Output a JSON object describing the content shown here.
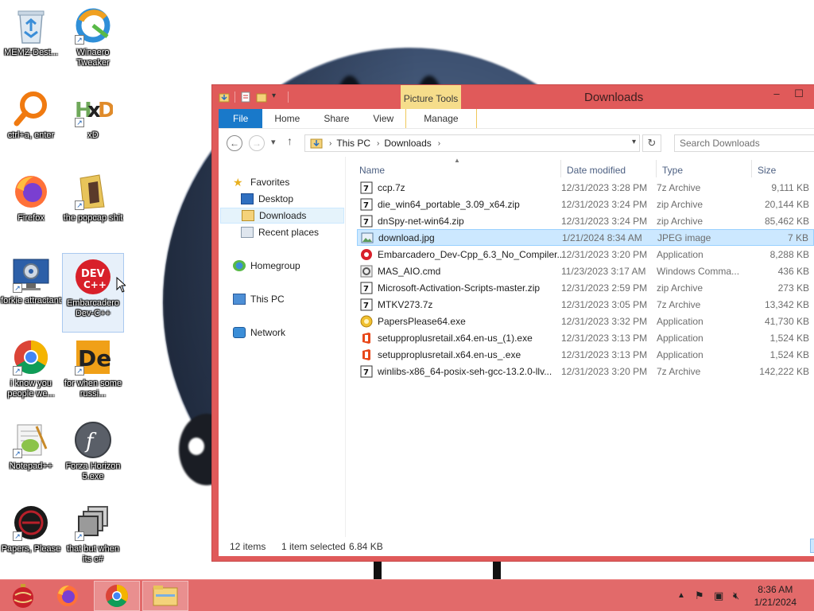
{
  "desktop": {
    "icons": [
      {
        "id": "memz",
        "label": "MEMZ-Dest..."
      },
      {
        "id": "winaero",
        "label": "Winaero Tweaker"
      },
      {
        "id": "ctrla",
        "label": "ctrl+a, enter"
      },
      {
        "id": "xd",
        "label": "xD"
      },
      {
        "id": "firefox",
        "label": "Firefox"
      },
      {
        "id": "popcap",
        "label": "the popcap shit"
      },
      {
        "id": "forkie",
        "label": "forkie attractant"
      },
      {
        "id": "embarcadero",
        "label": "Embarcadero Dev-C++"
      },
      {
        "id": "chrome",
        "label": "i know you people we..."
      },
      {
        "id": "forwhen",
        "label": "for when some russi..."
      },
      {
        "id": "notepadpp",
        "label": "Notepad++"
      },
      {
        "id": "forza",
        "label": "Forza Horizon 5.exe"
      },
      {
        "id": "papers",
        "label": "Papers, Please"
      },
      {
        "id": "thatbut",
        "label": "that but when its c#"
      }
    ]
  },
  "window": {
    "title": "Downloads",
    "contextual_tab_group": "Picture Tools",
    "tabs": [
      "File",
      "Home",
      "Share",
      "View",
      "Manage"
    ],
    "breadcrumb": [
      "This PC",
      "Downloads"
    ],
    "search_placeholder": "Search Downloads",
    "nav": {
      "favorites": "Favorites",
      "desktop": "Desktop",
      "downloads": "Downloads",
      "recent": "Recent places",
      "homegroup": "Homegroup",
      "thispc": "This PC",
      "network": "Network"
    },
    "columns": {
      "name": "Name",
      "date": "Date modified",
      "type": "Type",
      "size": "Size"
    },
    "files": [
      {
        "name": "ccp.7z",
        "date": "12/31/2023 3:28 PM",
        "type": "7z Archive",
        "size": "9,111 KB",
        "icon": "archive-icon"
      },
      {
        "name": "die_win64_portable_3.09_x64.zip",
        "date": "12/31/2023 3:24 PM",
        "type": "zip Archive",
        "size": "20,144 KB",
        "icon": "archive-icon"
      },
      {
        "name": "dnSpy-net-win64.zip",
        "date": "12/31/2023 3:24 PM",
        "type": "zip Archive",
        "size": "85,462 KB",
        "icon": "archive-icon"
      },
      {
        "name": "download.jpg",
        "date": "1/21/2024 8:34 AM",
        "type": "JPEG image",
        "size": "7 KB",
        "icon": "image-icon"
      },
      {
        "name": "Embarcadero_Dev-Cpp_6.3_No_Compiler...",
        "date": "12/31/2023 3:20 PM",
        "type": "Application",
        "size": "8,288 KB",
        "icon": "devcpp-icon"
      },
      {
        "name": "MAS_AIO.cmd",
        "date": "11/23/2023 3:17 AM",
        "type": "Windows Comma...",
        "size": "436 KB",
        "icon": "cmd-icon"
      },
      {
        "name": "Microsoft-Activation-Scripts-master.zip",
        "date": "12/31/2023 2:59 PM",
        "type": "zip Archive",
        "size": "273 KB",
        "icon": "archive-icon"
      },
      {
        "name": "MTKV273.7z",
        "date": "12/31/2023 3:05 PM",
        "type": "7z Archive",
        "size": "13,342 KB",
        "icon": "archive-icon"
      },
      {
        "name": "PapersPlease64.exe",
        "date": "12/31/2023 3:32 PM",
        "type": "Application",
        "size": "41,730 KB",
        "icon": "papers-icon"
      },
      {
        "name": "setupproplusretail.x64.en-us_(1).exe",
        "date": "12/31/2023 3:13 PM",
        "type": "Application",
        "size": "1,524 KB",
        "icon": "office-icon"
      },
      {
        "name": "setupproplusretail.x64.en-us_.exe",
        "date": "12/31/2023 3:13 PM",
        "type": "Application",
        "size": "1,524 KB",
        "icon": "office-icon"
      },
      {
        "name": "winlibs-x86_64-posix-seh-gcc-13.2.0-llv...",
        "date": "12/31/2023 3:20 PM",
        "type": "7z Archive",
        "size": "142,222 KB",
        "icon": "archive-icon"
      }
    ],
    "selected_file": "download.jpg",
    "status": {
      "count": "12 items",
      "selected": "1 item selected",
      "size": "6.84 KB"
    }
  },
  "taskbar": {
    "clock_time": "8:36 AM",
    "clock_date": "1/21/2024"
  },
  "colors": {
    "accent": "#e05a5a",
    "taskbar": "#e26a6a",
    "file_tab": "#1979ca",
    "picture_tools": "#f6dd8b",
    "selection": "#cce8ff"
  }
}
